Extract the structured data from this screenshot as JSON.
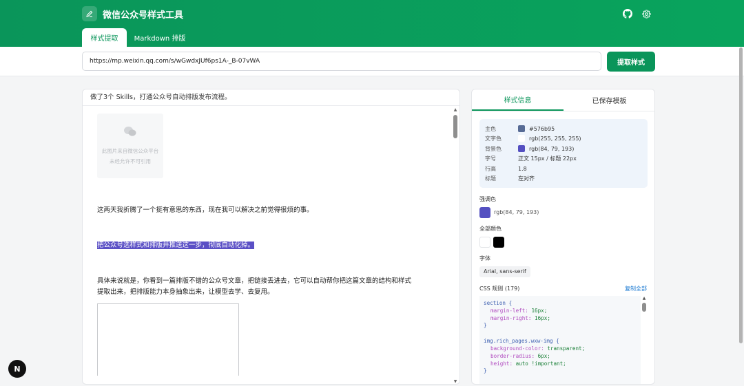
{
  "header": {
    "title": "微信公众号样式工具",
    "tabs": [
      "样式提取",
      "Markdown 排版"
    ],
    "icons": [
      "edit-icon",
      "github-icon",
      "gear-icon"
    ]
  },
  "url_bar": {
    "value": "https://mp.weixin.qq.com/s/wGwdxJUf6ps1A-_B-07vWA",
    "button_label": "提取样式"
  },
  "article": {
    "title": "做了3个 Skills，打通公众号自动排版发布流程。",
    "image_placeholder": [
      "此图片来自微信公众平台",
      "未经允许不可引用"
    ],
    "paragraphs": [
      "这两天我折腾了一个挺有意思的东西，现在我可以解决之前觉得很烦的事。",
      "把公众号选样式和排版并推送这一步，彻底自动化掉。",
      "具体来说就是，你看到一篇排版不错的公众号文章，把链接丢进去，它可以自动帮你把这篇文章的结构和样式",
      "提取出来，把排版能力本身抽象出来，让模型去学、去复用。"
    ]
  },
  "side_panel": {
    "tabs": [
      "样式信息",
      "已保存模板"
    ],
    "style_info": [
      {
        "key": "主色",
        "value": "#576b95",
        "swatch": "#576b95"
      },
      {
        "key": "文字色",
        "value": "rgb(255, 255, 255)",
        "swatch": "#ffffff"
      },
      {
        "key": "背景色",
        "value": "rgb(84, 79, 193)",
        "swatch": "#544fc1"
      },
      {
        "key": "字号",
        "value": "正文 15px / 标题 22px"
      },
      {
        "key": "行高",
        "value": "1.8"
      },
      {
        "key": "标题",
        "value": "左对齐"
      }
    ],
    "accent_label": "强调色",
    "accent_value": "rgb(84, 79, 193)",
    "accent_color": "#544fc1",
    "all_colors_label": "全部颜色",
    "all_colors": [
      "#ffffff",
      "#000000"
    ],
    "font_label": "字体",
    "font_value": "Arial, sans-serif",
    "css_rules_label": "CSS 规则 (179)",
    "copy_all_label": "复制全部",
    "css_blocks": [
      {
        "selector": "section {",
        "props": [
          [
            "margin-left",
            "16px;"
          ],
          [
            "margin-right",
            "16px;"
          ]
        ],
        "close": "}"
      },
      {
        "selector": "img.rich_pages.wxw-img {",
        "props": [
          [
            "background-color",
            "transparent;"
          ],
          [
            "border-radius",
            "6px;"
          ],
          [
            "height",
            "auto !important;"
          ]
        ],
        "close": "}"
      }
    ]
  },
  "badge": "N"
}
